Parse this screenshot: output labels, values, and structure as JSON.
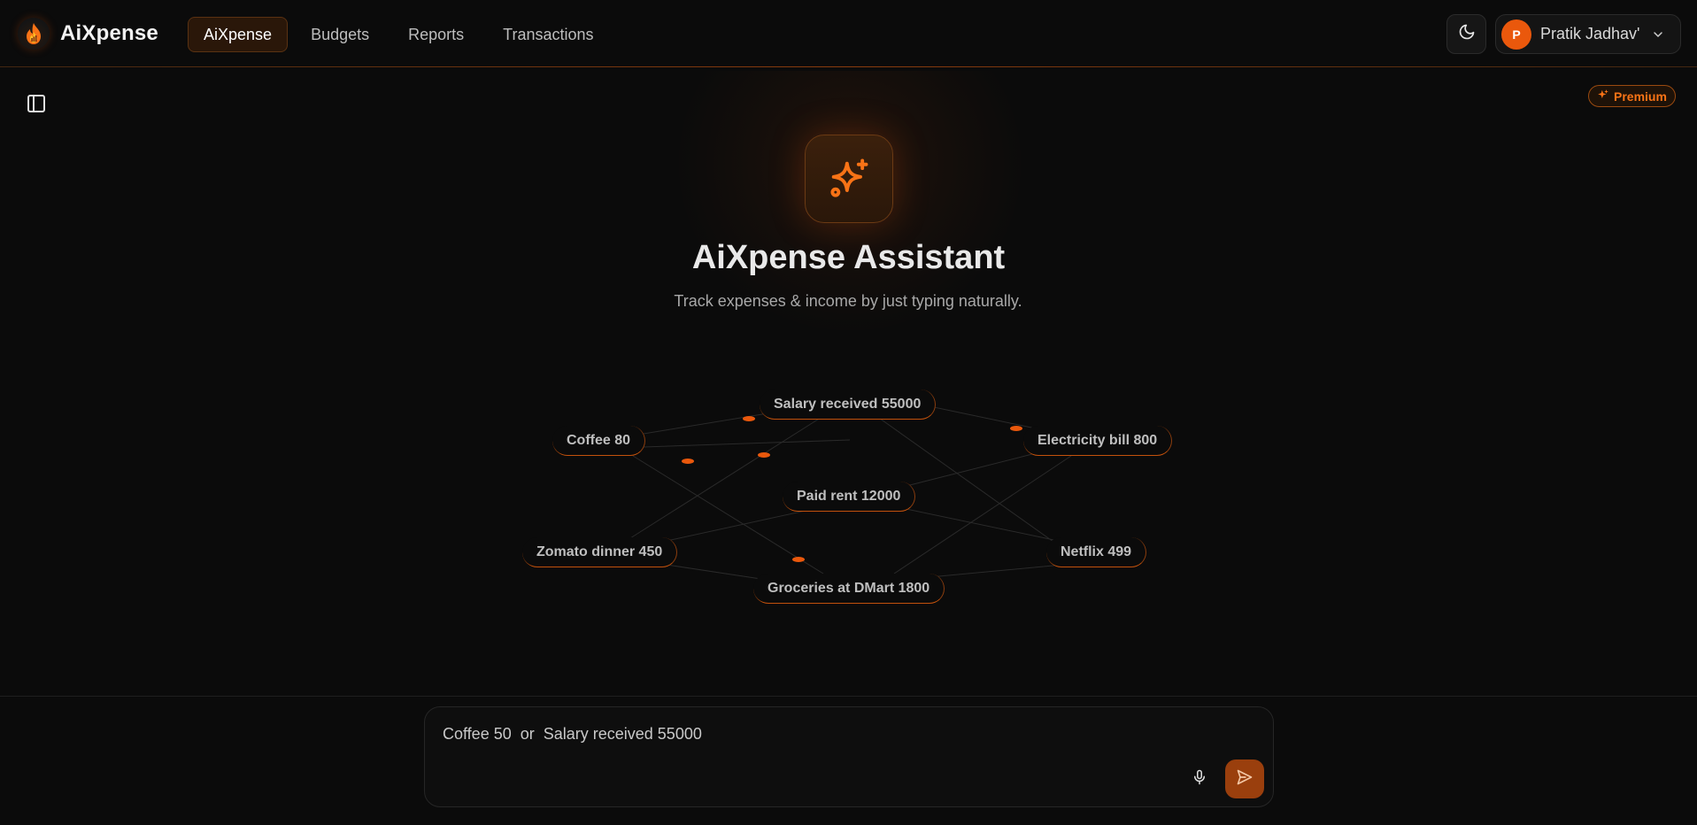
{
  "brand": {
    "name": "AiXpense",
    "logo_icon": "flame-chart-logo-icon"
  },
  "nav": {
    "items": [
      {
        "label": "AiXpense",
        "active": true
      },
      {
        "label": "Budgets",
        "active": false
      },
      {
        "label": "Reports",
        "active": false
      },
      {
        "label": "Transactions",
        "active": false
      }
    ]
  },
  "header": {
    "theme_icon": "moon-icon",
    "user": {
      "initial": "P",
      "name": "Pratik Jadhav'",
      "menu_icon": "chevron-down-icon"
    }
  },
  "sidebar_toggle_icon": "panel-left-icon",
  "premium_badge": {
    "label": "Premium",
    "icon": "sparkles-icon"
  },
  "hero": {
    "icon": "sparkles-icon",
    "title": "AiXpense Assistant",
    "subtitle": "Track expenses & income by just typing naturally."
  },
  "examples": [
    "Salary received 55000",
    "Coffee 80",
    "Electricity bill 800",
    "Paid rent 12000",
    "Zomato dinner 450",
    "Netflix 499",
    "Groceries at DMart 1800"
  ],
  "composer": {
    "placeholder": "Coffee 50  or  Salary received 55000",
    "mic_icon": "microphone-icon",
    "send_icon": "send-icon"
  },
  "colors": {
    "accent": "#ea580c",
    "background": "#0b0b0b"
  }
}
